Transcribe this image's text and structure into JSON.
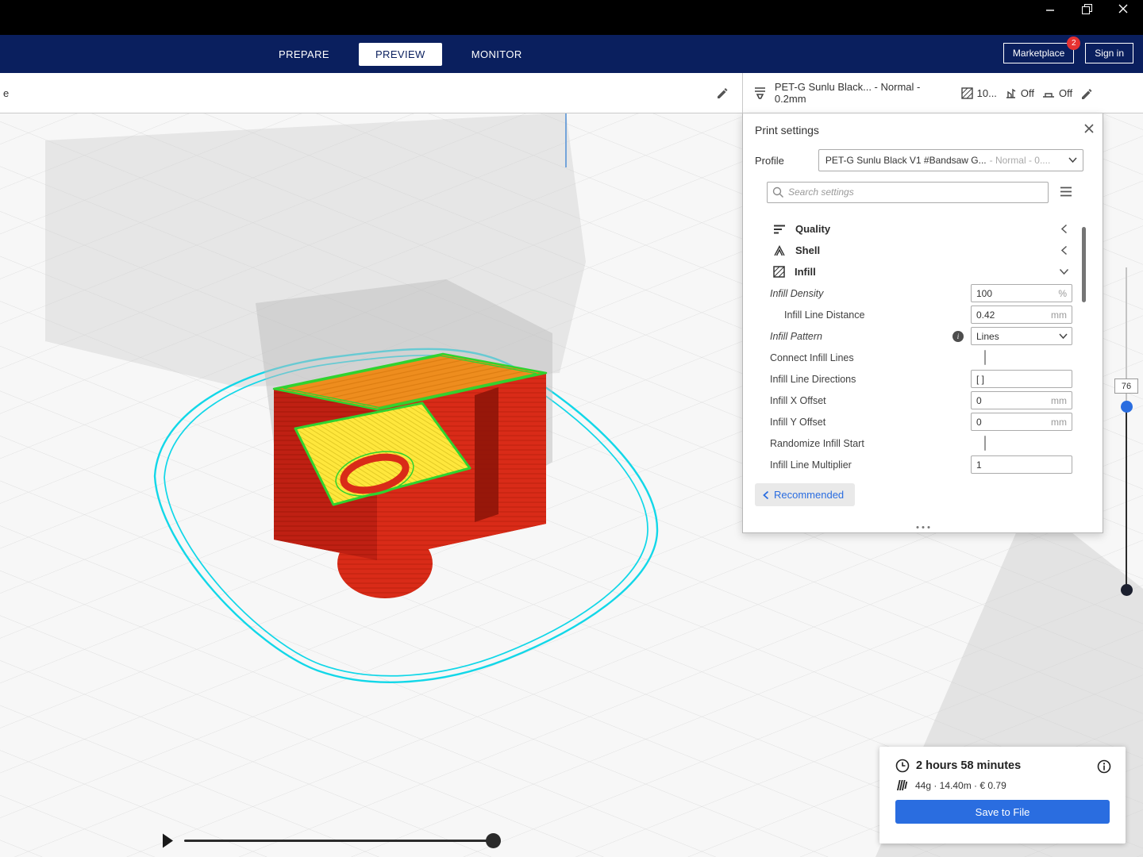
{
  "colors": {
    "accent_blue": "#2a6de0",
    "nav_navy": "#0a1f5e",
    "badge_red": "#e63232",
    "model_red": "#d92b18",
    "model_orange": "#ee8d1e",
    "model_yellow": "#ffe73c",
    "model_green": "#2fd32f",
    "brim_cyan": "#12d7e8"
  },
  "icons": {
    "window": [
      "minimize-icon",
      "restore-icon",
      "close-icon"
    ],
    "config": [
      "material-nozzle-icon",
      "infill-icon",
      "support-icon",
      "adhesion-icon",
      "pencil-icon"
    ],
    "panel": [
      "search-icon",
      "hamburger-icon",
      "quality-icon",
      "shell-icon",
      "infill-icon",
      "info-icon",
      "chevron-icons"
    ],
    "job": [
      "clock-icon",
      "material-spool-icon",
      "info-icon"
    ]
  },
  "nav": {
    "tabs": [
      {
        "label": "PREPARE",
        "active": false
      },
      {
        "label": "PREVIEW",
        "active": true
      },
      {
        "label": "MONITOR",
        "active": false
      }
    ],
    "marketplace": {
      "label": "Marketplace",
      "badge": "2"
    },
    "sign_in": {
      "label": "Sign in"
    }
  },
  "config_bar": {
    "printer_text": "e",
    "material_summary": "PET-G Sunlu Black... - Normal - 0.2mm",
    "infill_value": "10...",
    "support_value": "Off",
    "adhesion_value": "Off"
  },
  "print_settings": {
    "title": "Print settings",
    "profile_label": "Profile",
    "profile_value": "PET-G Sunlu Black V1 #Bandsaw G...",
    "profile_suffix": "- Normal - 0....",
    "search_placeholder": "Search settings",
    "categories": [
      {
        "label": "Quality",
        "state": "collapsed"
      },
      {
        "label": "Shell",
        "state": "collapsed"
      },
      {
        "label": "Infill",
        "state": "expanded"
      }
    ],
    "settings": [
      {
        "label": "Infill Density",
        "value": "100",
        "unit": "%"
      },
      {
        "label": "Infill Line Distance",
        "value": "0.42",
        "unit": "mm"
      },
      {
        "label": "Infill Pattern",
        "value": "Lines"
      },
      {
        "label": "Connect Infill Lines"
      },
      {
        "label": "Infill Line Directions",
        "value": "[ ]"
      },
      {
        "label": "Infill X Offset",
        "value": "0",
        "unit": "mm"
      },
      {
        "label": "Infill Y Offset",
        "value": "0",
        "unit": "mm"
      },
      {
        "label": "Randomize Infill Start"
      },
      {
        "label": "Infill Line Multiplier",
        "value": "1"
      }
    ],
    "recommended_label": "Recommended"
  },
  "viewport": {
    "layer_value": "76"
  },
  "job_summary": {
    "time": "2 hours 58 minutes",
    "material": "44g · 14.40m · € 0.79",
    "save_button": "Save to File"
  }
}
